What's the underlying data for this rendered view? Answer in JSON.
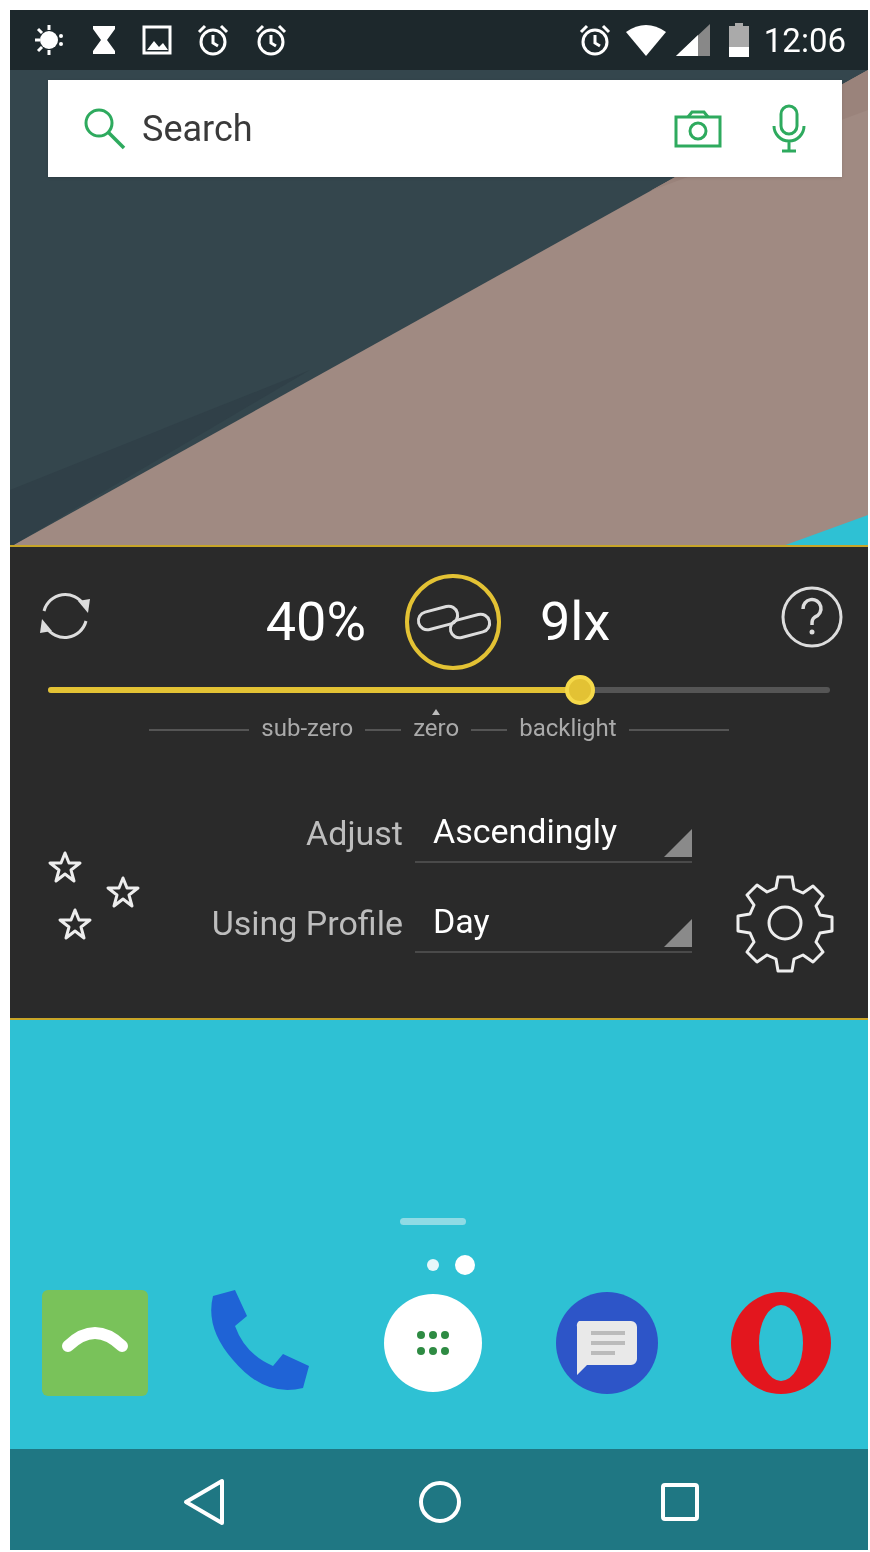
{
  "status_bar": {
    "time": "12:06"
  },
  "search": {
    "placeholder": "Search"
  },
  "widget": {
    "brightness": "40%",
    "illuminance": "9lx",
    "slider": {
      "level": 0.68
    },
    "scale_labels": [
      {
        "text": "sub-zero",
        "marked": false
      },
      {
        "text": "zero",
        "marked": true
      },
      {
        "text": "backlight",
        "marked": false
      }
    ],
    "settings": [
      {
        "label": "Adjust",
        "value": "Ascendingly"
      },
      {
        "label": "Using Profile",
        "value": "Day"
      }
    ]
  },
  "home": {
    "page_dots": [
      {
        "selected": false
      },
      {
        "selected": true
      }
    ]
  }
}
